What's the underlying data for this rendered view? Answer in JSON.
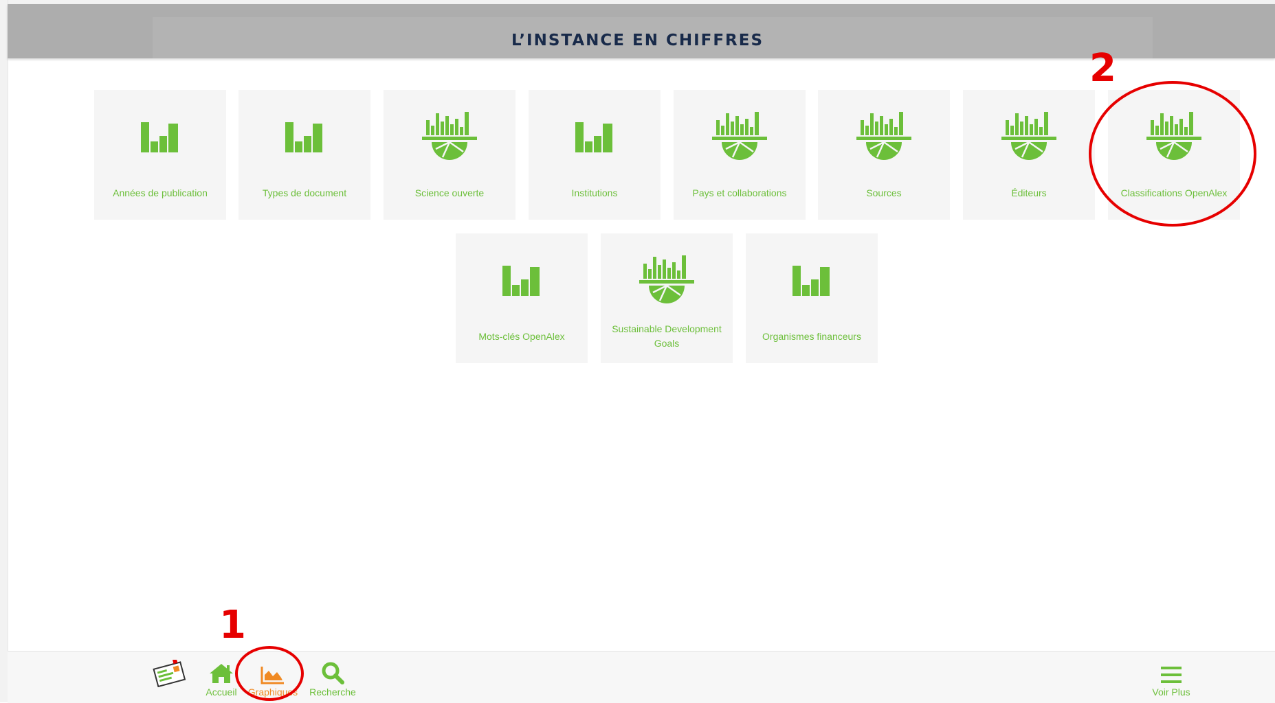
{
  "header": {
    "title": "L’INSTANCE EN CHIFFRES"
  },
  "tiles": [
    {
      "label": "Années de publication",
      "icon": "bar-chart-icon"
    },
    {
      "label": "Types de document",
      "icon": "bar-chart-icon"
    },
    {
      "label": "Science ouverte",
      "icon": "bar-pie-chart-icon"
    },
    {
      "label": "Institutions",
      "icon": "bar-chart-icon"
    },
    {
      "label": "Pays et collaborations",
      "icon": "bar-pie-chart-icon"
    },
    {
      "label": "Sources",
      "icon": "bar-pie-chart-icon"
    },
    {
      "label": "Éditeurs",
      "icon": "bar-pie-chart-icon"
    },
    {
      "label": "Classifications OpenAlex",
      "icon": "bar-pie-chart-icon"
    },
    {
      "label": "Mots-clés OpenAlex",
      "icon": "bar-chart-icon"
    },
    {
      "label": "Sustainable Development Goals",
      "icon": "bar-pie-chart-icon"
    },
    {
      "label": "Organismes financeurs",
      "icon": "bar-chart-icon"
    }
  ],
  "annotations": {
    "step1": "1",
    "step2": "2"
  },
  "footer": {
    "logo_icon": "app-logo-icon",
    "home_label": "Accueil",
    "charts_label": "Graphiques",
    "search_label": "Recherche",
    "more_label": "Voir Plus"
  },
  "colors": {
    "accent_green": "#6cbf3a",
    "active_orange": "#f08a24",
    "annotation_red": "#e60000",
    "header_text": "#182a4a"
  }
}
